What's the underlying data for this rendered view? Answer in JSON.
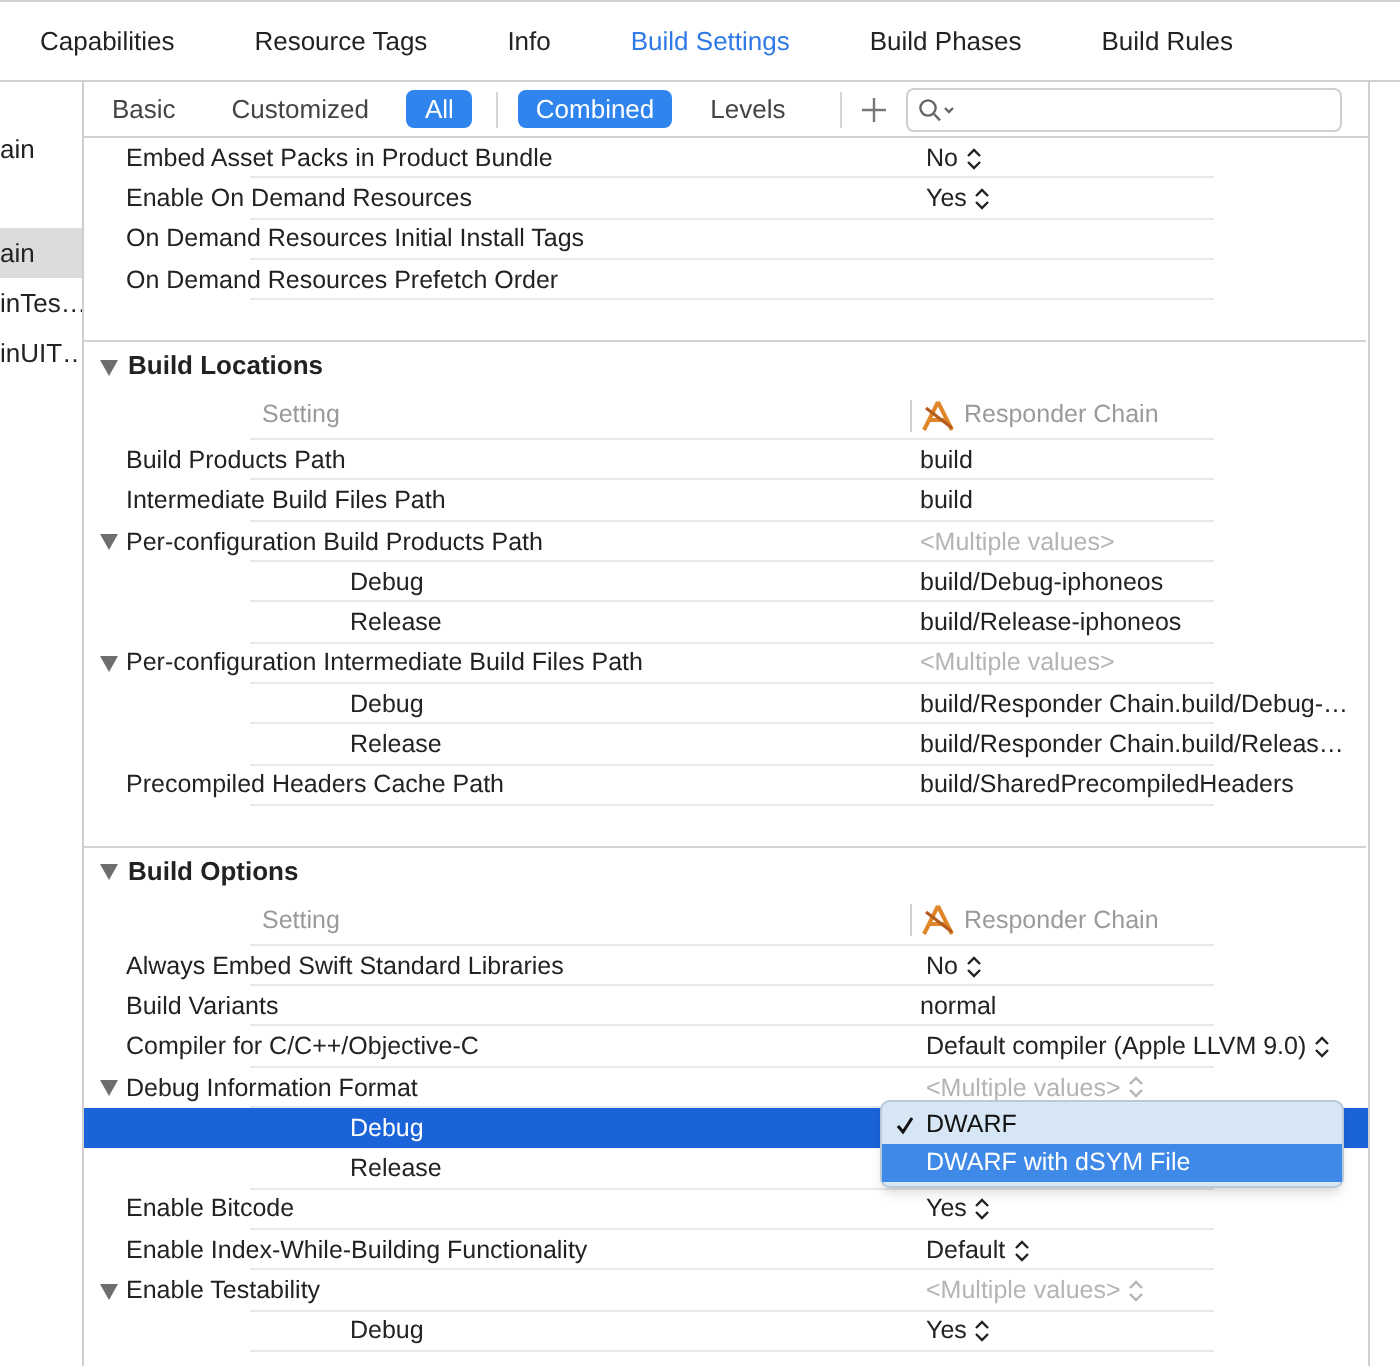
{
  "tabs": [
    {
      "label": "Capabilities",
      "selected": false
    },
    {
      "label": "Resource Tags",
      "selected": false
    },
    {
      "label": "Info",
      "selected": false
    },
    {
      "label": "Build Settings",
      "selected": true
    },
    {
      "label": "Build Phases",
      "selected": false
    },
    {
      "label": "Build Rules",
      "selected": false
    }
  ],
  "sidebar": {
    "items": [
      {
        "label": "ain",
        "selected": false
      },
      {
        "label": "ain",
        "selected": true
      },
      {
        "label": "inTes…",
        "selected": false
      },
      {
        "label": "inUIT…",
        "selected": false
      }
    ]
  },
  "filter_bar": {
    "scope": [
      {
        "label": "Basic",
        "selected": false
      },
      {
        "label": "Customized",
        "selected": false
      },
      {
        "label": "All",
        "selected": true
      }
    ],
    "view": [
      {
        "label": "Combined",
        "selected": true
      },
      {
        "label": "Levels",
        "selected": false
      }
    ]
  },
  "sections": [
    {
      "rows": [
        {
          "kind": "setting",
          "label": "Embed Asset Packs in Product Bundle",
          "value": "No",
          "popup": true,
          "greyed": false,
          "selected": false
        },
        {
          "kind": "setting",
          "label": "Enable On Demand Resources",
          "value": "Yes",
          "popup": true,
          "greyed": false,
          "selected": false
        },
        {
          "kind": "setting",
          "label": "On Demand Resources Initial Install Tags",
          "selected": false
        },
        {
          "kind": "setting",
          "label": "On Demand Resources Prefetch Order",
          "selected": false
        }
      ]
    },
    {
      "title": "Build Locations",
      "expanded": true,
      "column_header": {
        "setting": "Setting",
        "target": "Responder Chain"
      },
      "rows": [
        {
          "kind": "setting",
          "label": "Build Products Path",
          "value": "build",
          "popup": false,
          "greyed": false,
          "selected": false
        },
        {
          "kind": "setting",
          "label": "Intermediate Build Files Path",
          "value": "build",
          "popup": false,
          "greyed": false,
          "selected": false
        },
        {
          "kind": "group",
          "label": "Per-configuration Build Products Path",
          "expanded": true,
          "value": "<Multiple values>",
          "popup": false,
          "greyed": true,
          "selected": false
        },
        {
          "kind": "config",
          "label": "Debug",
          "value": "build/Debug-iphoneos",
          "popup": false,
          "greyed": false,
          "selected": false
        },
        {
          "kind": "config",
          "label": "Release",
          "value": "build/Release-iphoneos",
          "popup": false,
          "greyed": false,
          "selected": false
        },
        {
          "kind": "group",
          "label": "Per-configuration Intermediate Build Files Path",
          "expanded": true,
          "value": "<Multiple values>",
          "popup": false,
          "greyed": true,
          "selected": false
        },
        {
          "kind": "config",
          "label": "Debug",
          "value": "build/Responder Chain.build/Debug-…",
          "popup": false,
          "greyed": false,
          "selected": false
        },
        {
          "kind": "config",
          "label": "Release",
          "value": "build/Responder Chain.build/Releas…",
          "popup": false,
          "greyed": false,
          "selected": false
        },
        {
          "kind": "setting",
          "label": "Precompiled Headers Cache Path",
          "value": "build/SharedPrecompiledHeaders",
          "popup": false,
          "greyed": false,
          "selected": false
        }
      ]
    },
    {
      "title": "Build Options",
      "expanded": true,
      "column_header": {
        "setting": "Setting",
        "target": "Responder Chain"
      },
      "rows": [
        {
          "kind": "setting",
          "label": "Always Embed Swift Standard Libraries",
          "value": "No",
          "popup": true,
          "greyed": false,
          "selected": false
        },
        {
          "kind": "setting",
          "label": "Build Variants",
          "value": "normal",
          "popup": false,
          "greyed": false,
          "selected": false
        },
        {
          "kind": "setting",
          "label": "Compiler for C/C++/Objective-C",
          "value": "Default compiler (Apple LLVM 9.0)",
          "popup": true,
          "greyed": false,
          "selected": false
        },
        {
          "kind": "group",
          "label": "Debug Information Format",
          "expanded": true,
          "value": "<Multiple values>",
          "popup": true,
          "greyed": true,
          "selected": false
        },
        {
          "kind": "config",
          "label": "Debug",
          "selected": true,
          "menu": {
            "options": [
              {
                "label": "DWARF",
                "checked": true,
                "selected": false
              },
              {
                "label": "DWARF with dSYM File",
                "checked": false,
                "selected": true
              }
            ]
          }
        },
        {
          "kind": "config",
          "label": "Release",
          "selected": false
        },
        {
          "kind": "setting",
          "label": "Enable Bitcode",
          "value": "Yes",
          "popup": true,
          "greyed": false,
          "selected": false
        },
        {
          "kind": "setting",
          "label": "Enable Index-While-Building Functionality",
          "value": "Default",
          "popup": true,
          "greyed": false,
          "selected": false
        },
        {
          "kind": "group",
          "label": "Enable Testability",
          "expanded": true,
          "value": "<Multiple values>",
          "popup": true,
          "greyed": true,
          "selected": false
        },
        {
          "kind": "config",
          "label": "Debug",
          "value": "Yes",
          "popup": true,
          "greyed": false,
          "selected": false
        }
      ]
    }
  ]
}
